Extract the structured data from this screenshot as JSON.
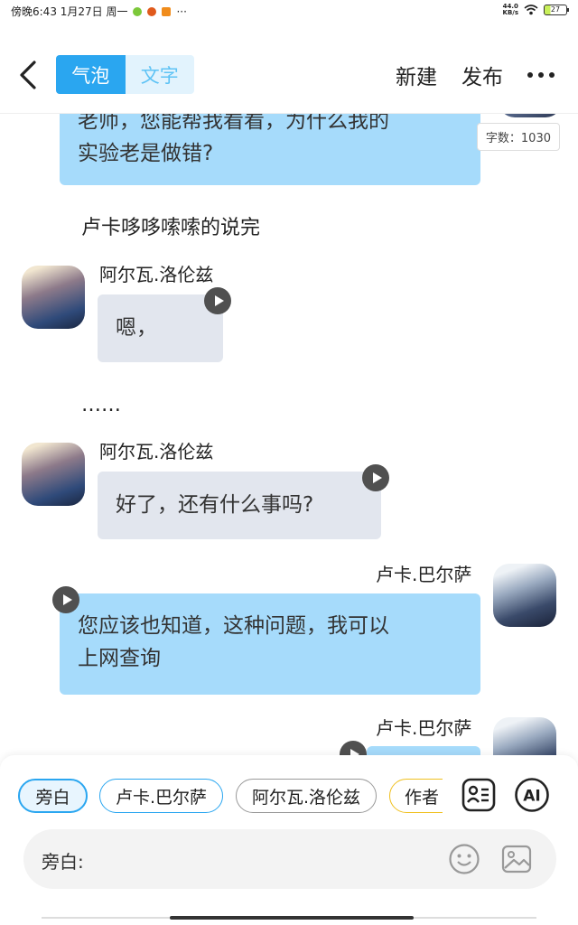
{
  "status_bar": {
    "time": "傍晚6:43 1月27日 周一",
    "more": "···",
    "net_speed_value": "44.0",
    "net_speed_unit": "KB/s",
    "battery": "27"
  },
  "header": {
    "tabs": [
      {
        "label": "气泡",
        "active": true
      },
      {
        "label": "文字",
        "active": false
      }
    ],
    "new_label": "新建",
    "publish_label": "发布"
  },
  "chat": {
    "word_count": "字数：1030",
    "messages": [
      {
        "speaker": "",
        "side": "right",
        "lines": [
          "老师，您能帮我看看，为什么我的",
          "实验老是做错?"
        ]
      },
      {
        "type": "narration",
        "text": "卢卡哆哆嗦嗦的说完"
      },
      {
        "speaker": "阿尔瓦.洛伦兹",
        "side": "left",
        "lines": [
          "嗯，"
        ]
      },
      {
        "type": "narration",
        "text": "……"
      },
      {
        "speaker": "阿尔瓦.洛伦兹",
        "side": "left",
        "lines": [
          "好了，还有什么事吗?"
        ]
      },
      {
        "speaker": "卢卡.巴尔萨",
        "side": "right",
        "lines": [
          "您应该也知道，这种问题，我可以",
          "上网查询"
        ]
      },
      {
        "speaker": "卢卡.巴尔萨",
        "side": "right",
        "lines": [
          ""
        ]
      }
    ]
  },
  "composer": {
    "chips": [
      "旁白",
      "卢卡.巴尔萨",
      "阿尔瓦.洛伦兹",
      "作者"
    ],
    "input_label": "旁白:",
    "input_value": ""
  },
  "colors": {
    "accent": "#2aa6f0",
    "bubble_blue": "#a6dbfb",
    "bubble_grey": "#e2e6ee",
    "chip_narration": "#2aa6f0",
    "chip_luca": "#2aa6f0",
    "chip_alva": "#888888",
    "chip_author": "#f0c020"
  }
}
